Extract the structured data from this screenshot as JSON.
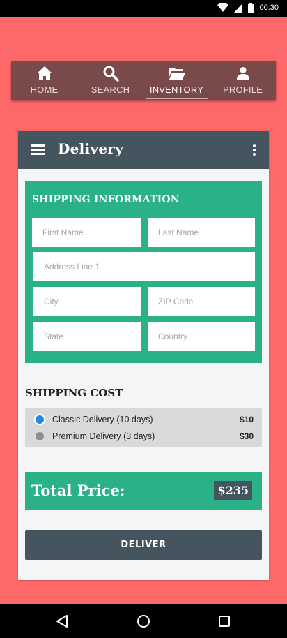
{
  "status_bar": {
    "time": "00:30"
  },
  "nav": {
    "items": [
      {
        "label": "HOME",
        "icon": "home-icon"
      },
      {
        "label": "SEARCH",
        "icon": "search-icon"
      },
      {
        "label": "INVENTORY",
        "icon": "folder-open-icon",
        "active": true
      },
      {
        "label": "PROFILE",
        "icon": "person-icon"
      }
    ]
  },
  "card": {
    "title": "Delivery",
    "shipping_info": {
      "title": "SHIPPING INFORMATION",
      "fields": {
        "first_name": {
          "placeholder": "First Name",
          "value": ""
        },
        "last_name": {
          "placeholder": "Last Name",
          "value": ""
        },
        "address": {
          "placeholder": "Address Line 1",
          "value": ""
        },
        "city": {
          "placeholder": "City",
          "value": ""
        },
        "zip": {
          "placeholder": "ZIP Code",
          "value": ""
        },
        "state": {
          "placeholder": "State",
          "value": ""
        },
        "country": {
          "placeholder": "Country",
          "value": ""
        }
      }
    },
    "shipping_cost": {
      "title": "SHIPPING COST",
      "options": [
        {
          "label": "Classic Delivery (10 days)",
          "price": "$10",
          "selected": true
        },
        {
          "label": "Premium Delivery (3 days)",
          "price": "$30",
          "selected": false
        }
      ]
    },
    "total": {
      "label": "Total Price:",
      "value": "$235"
    },
    "deliver_label": "DELIVER"
  },
  "colors": {
    "background": "#ff6868",
    "nav_bar": "#7a4a4a",
    "header": "#455560",
    "accent_green": "#2bb187",
    "radio_selected": "#1e88e5"
  }
}
